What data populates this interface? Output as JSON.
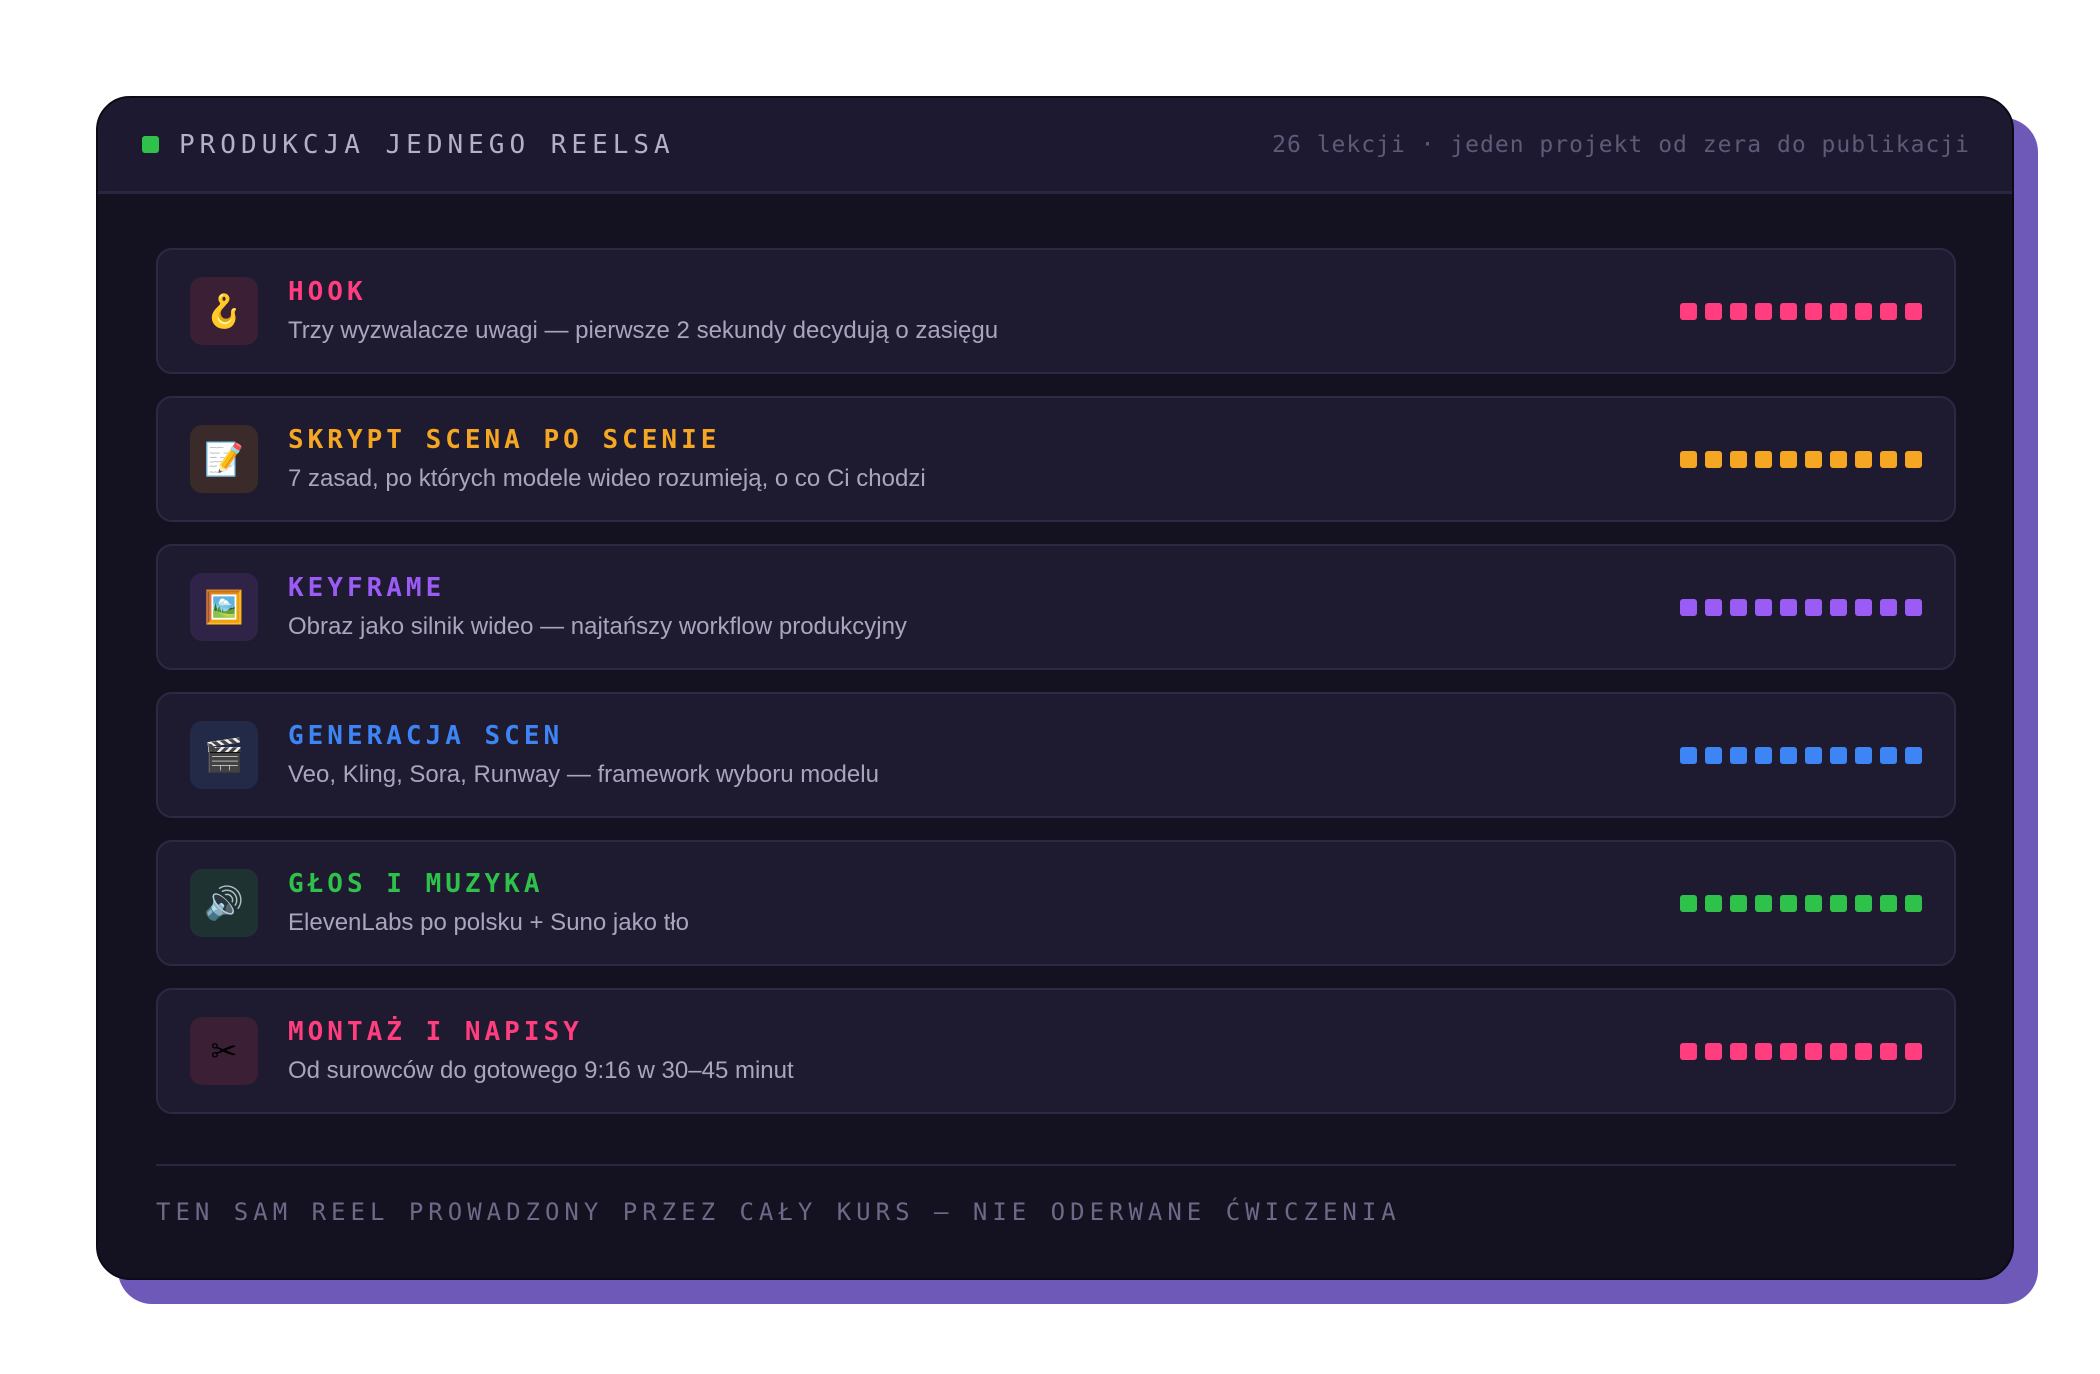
{
  "header": {
    "title": "PRODUKCJA JEDNEGO REELSA",
    "meta": "26 lekcji · jeden projekt od zera do publikacji",
    "status_color": "#2fc24a"
  },
  "modules": [
    {
      "title": "HOOK",
      "subtitle": "Trzy wyzwalacze uwagi — pierwsze 2 sekundy decydują o zasięgu",
      "icon": "🪝",
      "icon_name": "hook-icon",
      "color": "#ff3d7f",
      "tile": "#3a1f35",
      "dots": 10
    },
    {
      "title": "SKRYPT SCENA PO SCENIE",
      "subtitle": "7 zasad, po których modele wideo rozumieją, o co Ci chodzi",
      "icon": "📝",
      "icon_name": "memo-icon",
      "color": "#f5a623",
      "tile": "#3a2b2a",
      "dots": 10
    },
    {
      "title": "KEYFRAME",
      "subtitle": "Obraz jako silnik wideo — najtańszy workflow produkcyjny",
      "icon": "🖼️",
      "icon_name": "framed-picture-icon",
      "color": "#9a5cf5",
      "tile": "#2f2348",
      "dots": 10
    },
    {
      "title": "GENERACJA SCEN",
      "subtitle": "Veo, Kling, Sora, Runway — framework wyboru modelu",
      "icon": "🎬",
      "icon_name": "clapper-board-icon",
      "color": "#3d84f5",
      "tile": "#222a48",
      "dots": 10
    },
    {
      "title": "GŁOS I MUZYKA",
      "subtitle": "ElevenLabs po polsku + Suno jako tło",
      "icon": "🔊",
      "icon_name": "speaker-icon",
      "color": "#2fc24a",
      "tile": "#1f3232",
      "dots": 10
    },
    {
      "title": "MONTAŻ I NAPISY",
      "subtitle": "Od surowców do gotowego 9:16 w 30–45 minut",
      "icon": "✂",
      "icon_name": "scissors-icon",
      "color": "#ff3d7f",
      "tile": "#3a1f35",
      "dots": 10
    }
  ],
  "footer": {
    "text": "TEN SAM REEL PROWADZONY PRZEZ CAŁY KURS — NIE ODERWANE ĆWICZENIA"
  }
}
